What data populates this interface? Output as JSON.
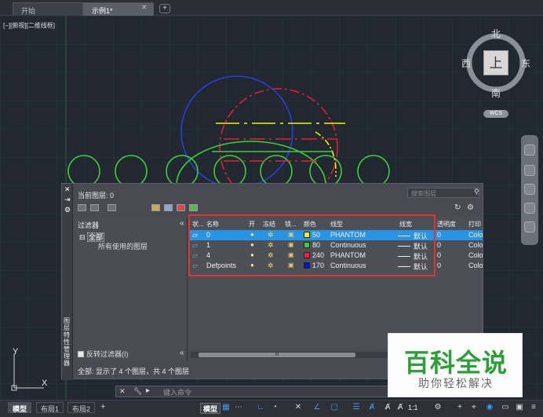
{
  "tabs": [
    {
      "label": "开始"
    },
    {
      "label": "示例1*"
    }
  ],
  "tab_close": "✕",
  "tab_add": "+",
  "canvas": {
    "view_label": "[−][俯视][二维线框]"
  },
  "viewcube": {
    "north": "北",
    "south": "南",
    "east": "东",
    "west": "西",
    "face": "上",
    "wcs": "WCS"
  },
  "ucs": {
    "x": "X",
    "y": "Y"
  },
  "layer_panel": {
    "side_title": "图层特性管理器",
    "current_layer": "当前图层: 0",
    "search_placeholder": "搜索图层",
    "filter_header": "过滤器",
    "tree_all": "全部",
    "tree_used": "所有使用的图层",
    "invert_filter": "反转过滤器(I)",
    "status": "全部: 显示了 4 个图层，共 4 个图层",
    "columns": [
      "状...",
      "名称",
      "开",
      "冻结",
      "锁...",
      "颜色",
      "线型",
      "线宽",
      "透明度",
      "打印"
    ],
    "rows": [
      {
        "name": "0",
        "color_value": "50",
        "color": "#f2f200",
        "linetype": "PHANTOM",
        "lineweight": "默认",
        "transparency": "0",
        "plot": "Colo"
      },
      {
        "name": "1",
        "color_value": "80",
        "color": "#3dcc3d",
        "linetype": "Continuous",
        "lineweight": "默认",
        "transparency": "0",
        "plot": "Colo"
      },
      {
        "name": "4",
        "color_value": "240",
        "color": "#ff1f3c",
        "linetype": "PHANTOM",
        "lineweight": "默认",
        "transparency": "0",
        "plot": "Colo"
      },
      {
        "name": "Defpoints",
        "color_value": "170",
        "color": "#0014c8",
        "linetype": "Continuous",
        "lineweight": "默认",
        "transparency": "0",
        "plot": "Colo"
      }
    ],
    "scroll_grip": "III"
  },
  "command_line": {
    "placeholder": "键入命令"
  },
  "layout_tabs": [
    "模型",
    "布局1",
    "布局2"
  ],
  "layout_add": "+",
  "status_bar": {
    "model": "模型",
    "scale": "1:1"
  },
  "watermark": {
    "title": "百科全说",
    "subtitle": "助你轻松解决"
  },
  "colors": {
    "selection": "#2894e4",
    "highlight_box": "#e53333",
    "circle_green": "#3fcc3f",
    "circle_blue": "#2a3fd8",
    "circle_red": "#e02035",
    "line_yellow": "#f2f200"
  }
}
